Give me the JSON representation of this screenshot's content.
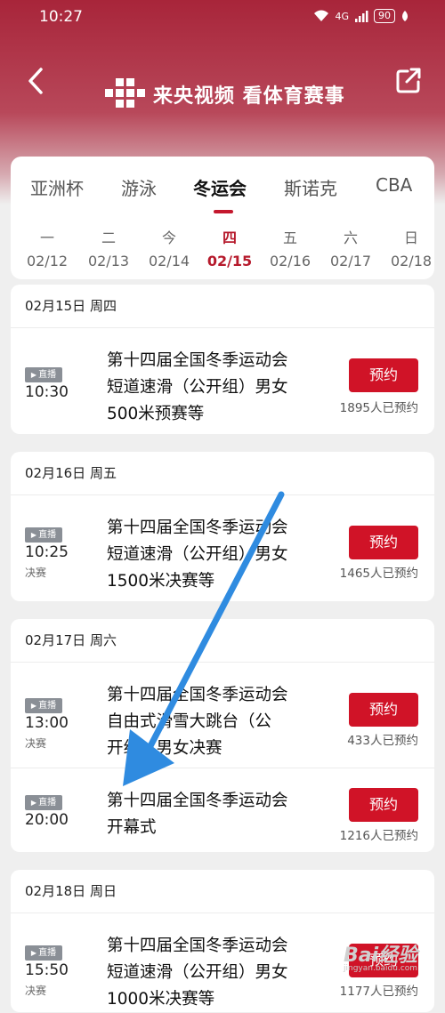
{
  "status": {
    "time": "10:27",
    "network": "4G",
    "battery": "90"
  },
  "header": {
    "brand": "来央视频 看体育赛事",
    "back_icon": "chevron-left-icon",
    "share_icon": "share-out-icon"
  },
  "tabs": [
    {
      "label": "亚洲杯",
      "active": false
    },
    {
      "label": "游泳",
      "active": false
    },
    {
      "label": "冬运会",
      "active": true
    },
    {
      "label": "斯诺克",
      "active": false
    },
    {
      "label": "CBA",
      "active": false
    }
  ],
  "dates": [
    {
      "dow": "一",
      "day": "02/12"
    },
    {
      "dow": "二",
      "day": "02/13"
    },
    {
      "dow": "今",
      "day": "02/14"
    },
    {
      "dow": "四",
      "day": "02/15",
      "active": true
    },
    {
      "dow": "五",
      "day": "02/16"
    },
    {
      "dow": "六",
      "day": "02/17"
    },
    {
      "dow": "日",
      "day": "02/18"
    }
  ],
  "accent_color": "#d01327",
  "sections": [
    {
      "date": "02月15日 周四",
      "events": [
        {
          "badge": "直播",
          "time": "10:30",
          "stage": "",
          "title_lines": [
            "第十四届全国冬季运动会",
            "短道速滑（公开组）男女",
            "500米预赛等"
          ],
          "button": "预约",
          "count": "1895人已预约"
        }
      ]
    },
    {
      "date": "02月16日 周五",
      "events": [
        {
          "badge": "直播",
          "time": "10:25",
          "stage": "决赛",
          "title_lines": [
            "第十四届全国冬季运动会",
            "短道速滑（公开组）男女",
            "1500米决赛等"
          ],
          "button": "预约",
          "count": "1465人已预约"
        }
      ]
    },
    {
      "date": "02月17日 周六",
      "events": [
        {
          "badge": "直播",
          "time": "13:00",
          "stage": "决赛",
          "title_lines": [
            "第十四届全国冬季运动会",
            "自由式滑雪大跳台（公",
            "开组）男女决赛"
          ],
          "button": "预约",
          "count": "433人已预约"
        },
        {
          "badge": "直播",
          "time": "20:00",
          "stage": "",
          "title_lines": [
            "第十四届全国冬季运动会",
            "开幕式"
          ],
          "button": "预约",
          "count": "1216人已预约"
        }
      ]
    },
    {
      "date": "02月18日 周日",
      "events": [
        {
          "badge": "直播",
          "time": "15:50",
          "stage": "决赛",
          "title_lines": [
            "第十四届全国冬季运动会",
            "短道速滑（公开组）男女",
            "1000米决赛等"
          ],
          "button": "预约",
          "count": "1177人已预约"
        }
      ]
    }
  ],
  "watermark": {
    "text": "Bai经验",
    "sub": "jingyan.baidu.com"
  }
}
